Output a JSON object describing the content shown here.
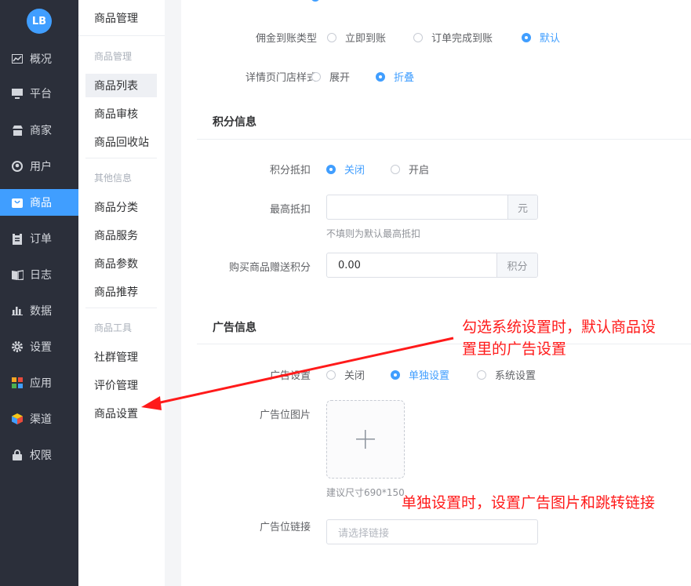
{
  "nav": {
    "logo_text": "LB",
    "items": [
      {
        "label": "概况",
        "icon": "chart-icon"
      },
      {
        "label": "平台",
        "icon": "monitor-icon"
      },
      {
        "label": "商家",
        "icon": "store-icon"
      },
      {
        "label": "用户",
        "icon": "user-icon"
      },
      {
        "label": "商品",
        "icon": "bag-icon"
      },
      {
        "label": "订单",
        "icon": "clipboard-icon"
      },
      {
        "label": "日志",
        "icon": "book-icon"
      },
      {
        "label": "数据",
        "icon": "bar-chart-icon"
      },
      {
        "label": "设置",
        "icon": "gear-icon"
      },
      {
        "label": "应用",
        "icon": "apps-grid-icon"
      },
      {
        "label": "渠道",
        "icon": "cube-icon"
      },
      {
        "label": "权限",
        "icon": "lock-icon"
      }
    ],
    "active_index": 4
  },
  "submenu": {
    "title": "商品管理",
    "groups": [
      {
        "title": "商品管理",
        "items": [
          "商品列表",
          "商品审核",
          "商品回收站"
        ]
      },
      {
        "title": "其他信息",
        "items": [
          "商品分类",
          "商品服务",
          "商品参数",
          "商品推荐"
        ]
      },
      {
        "title": "商品工具",
        "items": [
          "社群管理",
          "评价管理",
          "商品设置"
        ]
      }
    ],
    "active_item": "商品列表"
  },
  "form": {
    "commission": {
      "label": "佣金到账类型",
      "options": [
        "立即到账",
        "订单完成到账",
        "默认"
      ],
      "selected": 2
    },
    "store_style": {
      "label": "详情页门店样式",
      "options": [
        "展开",
        "折叠"
      ],
      "selected": 1
    },
    "points_section": "积分信息",
    "points_deduct": {
      "label": "积分抵扣",
      "options": [
        "关闭",
        "开启"
      ],
      "selected": 0
    },
    "max_deduct": {
      "label": "最高抵扣",
      "value": "",
      "suffix": "元",
      "hint": "不填则为默认最高抵扣"
    },
    "gift_points": {
      "label": "购买商品赠送积分",
      "value": "0.00",
      "suffix": "积分"
    },
    "ad_section": "广告信息",
    "ad_setting": {
      "label": "广告设置",
      "options": [
        "关闭",
        "单独设置",
        "系统设置"
      ],
      "selected": 1
    },
    "ad_image": {
      "label": "广告位图片",
      "hint": "建议尺寸690*150"
    },
    "ad_link": {
      "label": "广告位链接",
      "placeholder": "请选择链接"
    }
  },
  "annotations": {
    "note1_line1": "勾选系统设置时，默认商品设",
    "note1_line2": "置里的广告设置",
    "note2": "单独设置时，设置广告图片和跳转链接",
    "color": "#ff1a1a"
  },
  "colors": {
    "accent": "#409eff",
    "nav_bg": "#2b2f3a"
  }
}
